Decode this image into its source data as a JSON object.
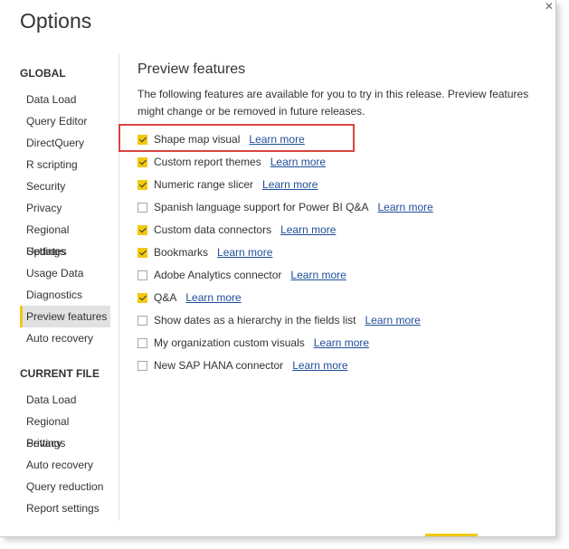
{
  "dialog": {
    "title": "Options"
  },
  "sidebar": {
    "global_heading": "GLOBAL",
    "global_items": [
      "Data Load",
      "Query Editor",
      "DirectQuery",
      "R scripting",
      "Security",
      "Privacy",
      "Regional Settings",
      "Updates",
      "Usage Data",
      "Diagnostics",
      "Preview features",
      "Auto recovery"
    ],
    "selected": "Preview features",
    "current_file_heading": "CURRENT FILE",
    "current_file_items": [
      "Data Load",
      "Regional Settings",
      "Privacy",
      "Auto recovery",
      "Query reduction",
      "Report settings"
    ]
  },
  "content": {
    "title": "Preview features",
    "description": "The following features are available for you to try in this release. Preview features might change or be removed in future releases.",
    "features": [
      {
        "label": "Shape map visual",
        "checked": true,
        "link": "Learn more"
      },
      {
        "label": "Custom report themes",
        "checked": true,
        "link": "Learn more"
      },
      {
        "label": "Numeric range slicer",
        "checked": true,
        "link": "Learn more"
      },
      {
        "label": "Spanish language support for Power BI Q&A",
        "checked": false,
        "link": "Learn more"
      },
      {
        "label": "Custom data connectors",
        "checked": true,
        "link": "Learn more"
      },
      {
        "label": "Bookmarks",
        "checked": true,
        "link": "Learn more"
      },
      {
        "label": "Adobe Analytics connector",
        "checked": false,
        "link": "Learn more"
      },
      {
        "label": "Q&A",
        "checked": true,
        "link": "Learn more"
      },
      {
        "label": "Show dates as a hierarchy in the fields list",
        "checked": false,
        "link": "Learn more"
      },
      {
        "label": "My organization custom visuals",
        "checked": false,
        "link": "Learn more"
      },
      {
        "label": "New SAP HANA connector",
        "checked": false,
        "link": "Learn more"
      }
    ]
  },
  "colors": {
    "accent": "#f2c811",
    "link": "#1f4e99",
    "highlight": "#d9453f"
  }
}
